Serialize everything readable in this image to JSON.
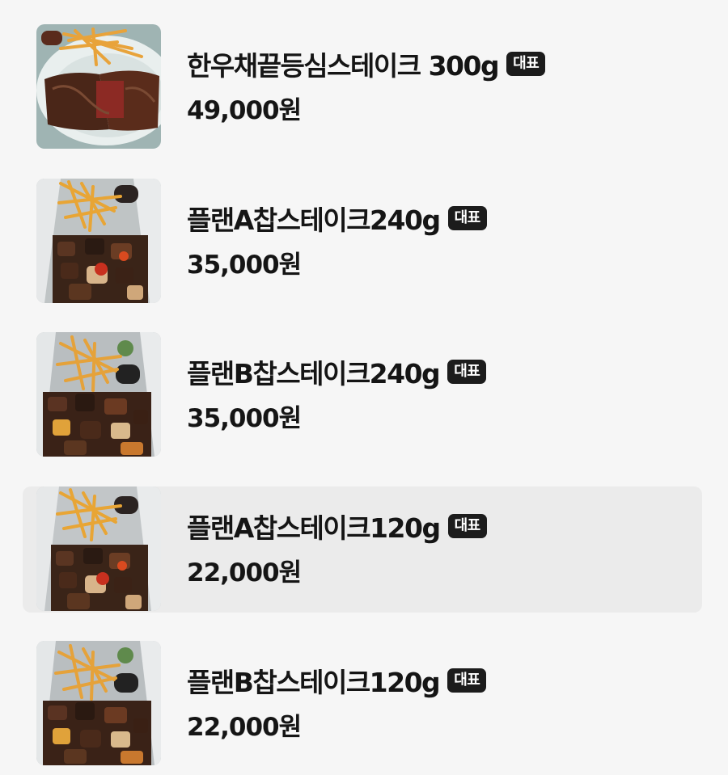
{
  "menu": {
    "items": [
      {
        "name": "한우채끝등심스테이크 300g",
        "badge": "대표",
        "price": "49,000원",
        "image_icon": "steak-photo"
      },
      {
        "name": "플랜A찹스테이크240g",
        "badge": "대표",
        "price": "35,000원",
        "image_icon": "chop-steak-photo"
      },
      {
        "name": "플랜B찹스테이크240g",
        "badge": "대표",
        "price": "35,000원",
        "image_icon": "chop-steak-photo"
      },
      {
        "name": "플랜A찹스테이크120g",
        "badge": "대표",
        "price": "22,000원",
        "image_icon": "chop-steak-photo"
      },
      {
        "name": "플랜B찹스테이크120g",
        "badge": "대표",
        "price": "22,000원",
        "image_icon": "chop-steak-photo"
      }
    ]
  },
  "colors": {
    "background": "#f6f6f6",
    "highlight": "#ebebeb",
    "badge_background": "#1c1c1c",
    "badge_text": "#ffffff"
  }
}
